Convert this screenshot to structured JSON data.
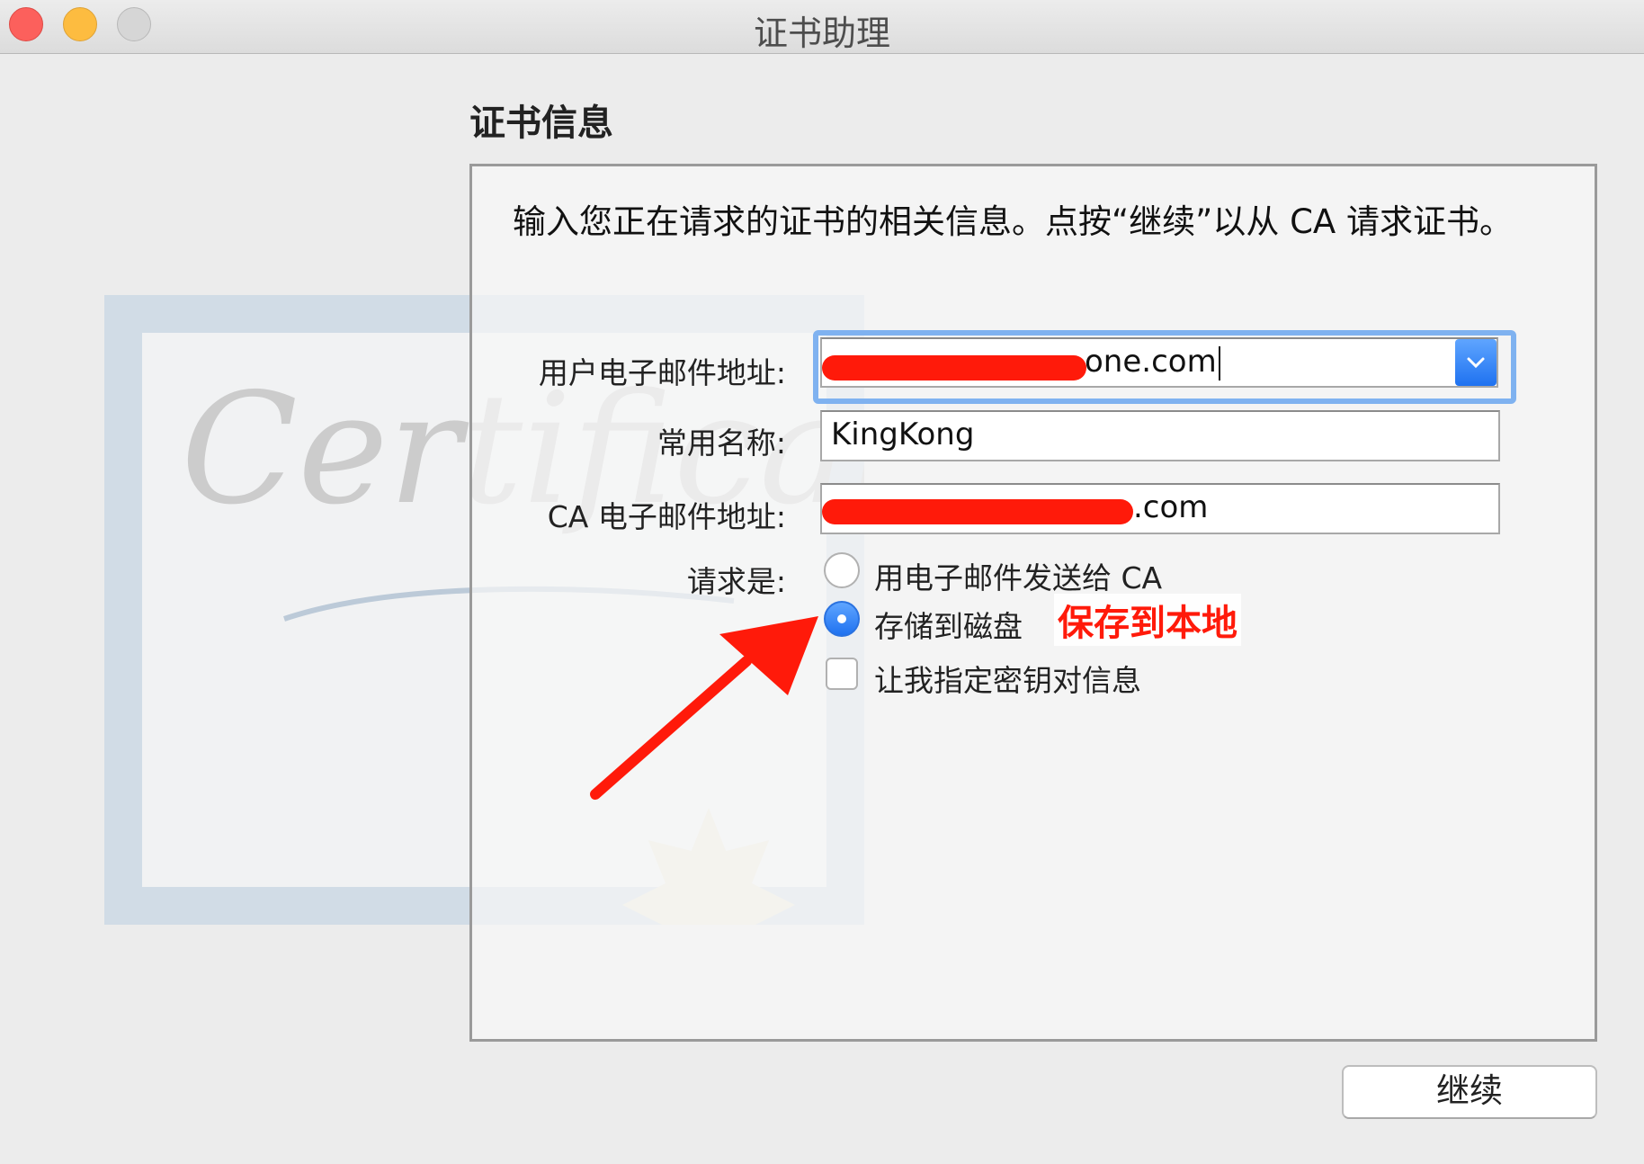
{
  "window": {
    "title": "证书助理"
  },
  "section_title": "证书信息",
  "instruction": "输入您正在请求的证书的相关信息。点按“继续”以从 CA 请求证书。",
  "form": {
    "user_email_label": "用户电子邮件地址:",
    "user_email_visible": "one.com",
    "common_name_label": "常用名称:",
    "common_name_value": "KingKong",
    "ca_email_label": "CA 电子邮件地址:",
    "ca_email_visible": ".com",
    "request_label": "请求是:",
    "options": {
      "email_ca": "用电子邮件发送给 CA",
      "save_disk": "存储到磁盘",
      "specify_keypair": "让我指定密钥对信息"
    },
    "selected_option": "save_disk"
  },
  "annotation": "保存到本地",
  "watermark": "Certificate",
  "buttons": {
    "continue": "继续"
  },
  "colors": {
    "accent": "#1f72f0",
    "annotation": "#ff1a0a"
  }
}
